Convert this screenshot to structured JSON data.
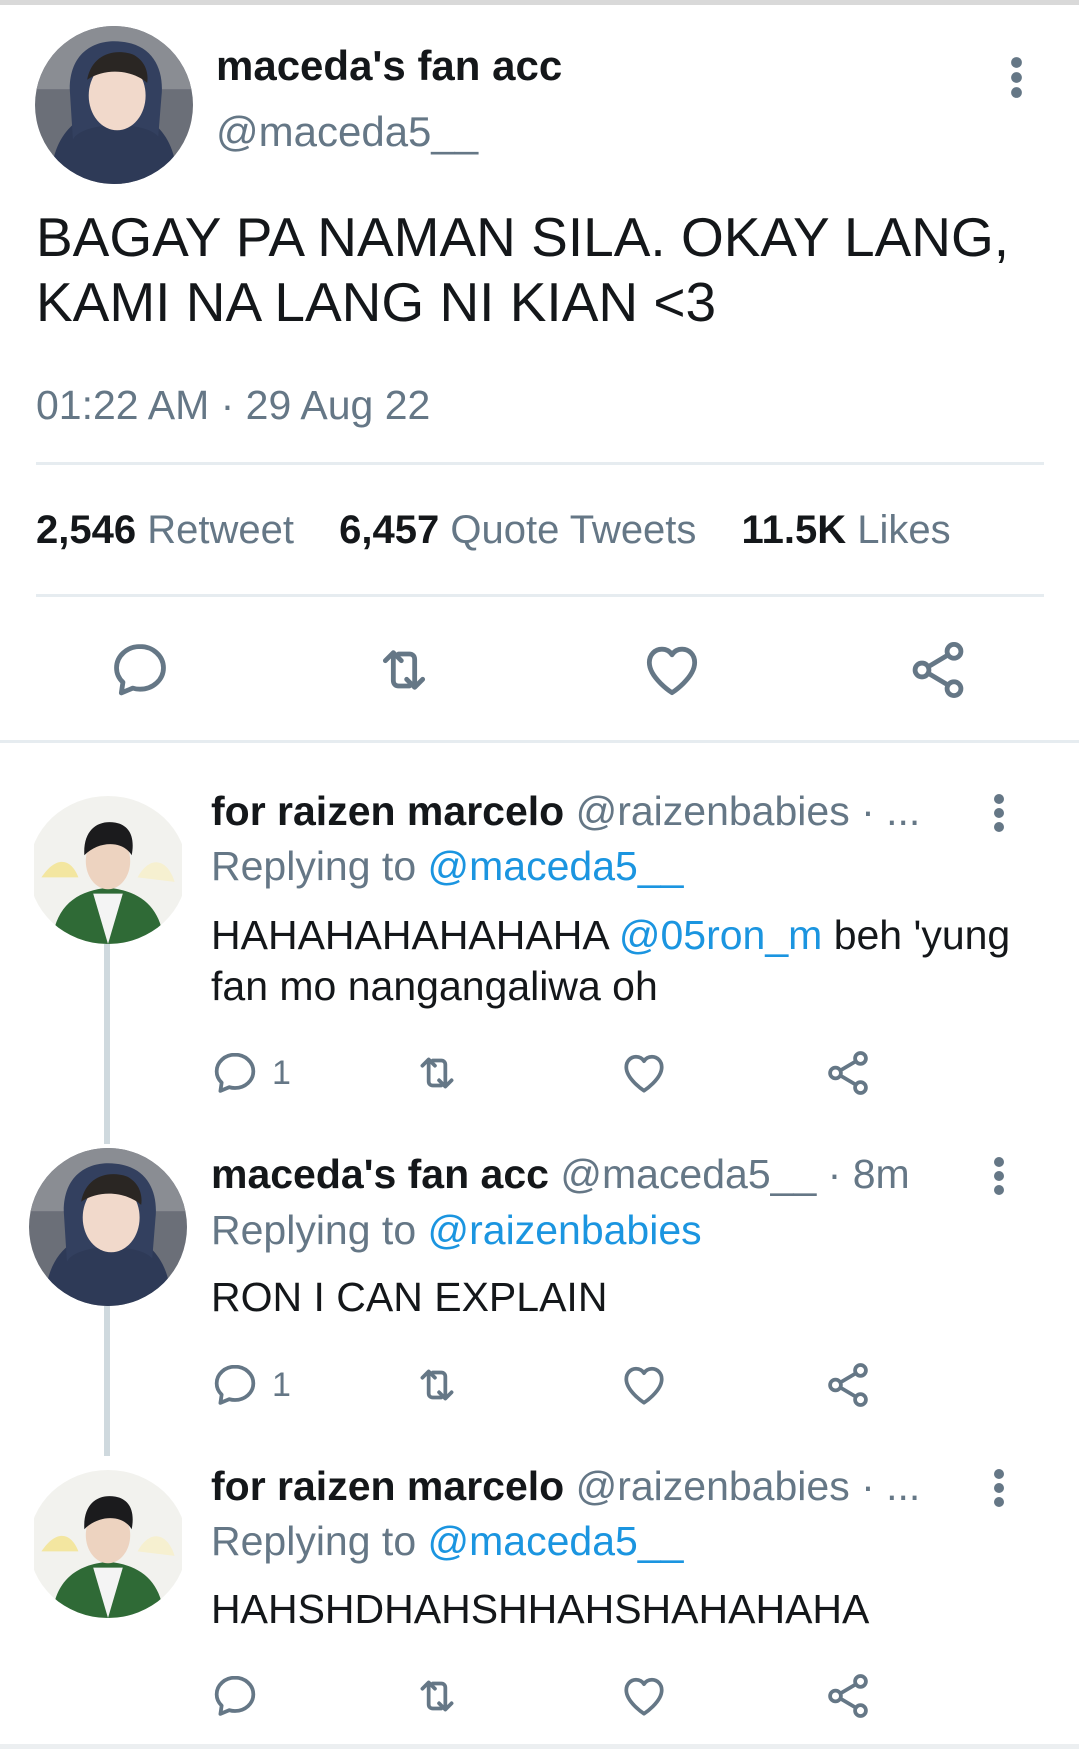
{
  "main_tweet": {
    "display_name": "maceda's fan acc",
    "handle": "@maceda5__",
    "text": "BAGAY PA NAMAN SILA. OKAY LANG, KAMI NA LANG NI KIAN <3",
    "timestamp": "01:22 AM · 29 Aug 22",
    "stats": {
      "retweets_count": "2,546",
      "retweets_label": "Retweet",
      "quotes_count": "6,457",
      "quotes_label": "Quote Tweets",
      "likes_count": "11.5K",
      "likes_label": "Likes"
    },
    "actions": [
      "reply-icon",
      "retweet-icon",
      "like-icon",
      "share-icon"
    ]
  },
  "replies": [
    {
      "display_name": "for raizen marcelo",
      "handle": "@raizenbabies",
      "time_suffix": "· ...",
      "replying_prefix": "Replying to",
      "replying_to": "@maceda5__",
      "text_before": "HAHAHAHAHAHAHA",
      "mention": "@05ron_m",
      "text_after": "beh 'yung fan mo nangangaliwa oh",
      "reply_count": "1"
    },
    {
      "display_name": "maceda's fan acc",
      "handle": "@maceda5__",
      "time_suffix": "· 8m",
      "replying_prefix": "Replying to",
      "replying_to": "@raizenbabies",
      "text": "RON I CAN EXPLAIN",
      "reply_count": "1"
    },
    {
      "display_name": "for raizen marcelo",
      "handle": "@raizenbabies",
      "time_suffix": "· ...",
      "replying_prefix": "Replying to",
      "replying_to": "@maceda5__",
      "text": "HAHSHDHAHSHHAHSHAHAHAHA",
      "reply_count": ""
    }
  ],
  "colors": {
    "text": "#14171a",
    "secondary": "#657786",
    "link": "#1b95e0",
    "divider": "#e6ecf0"
  }
}
